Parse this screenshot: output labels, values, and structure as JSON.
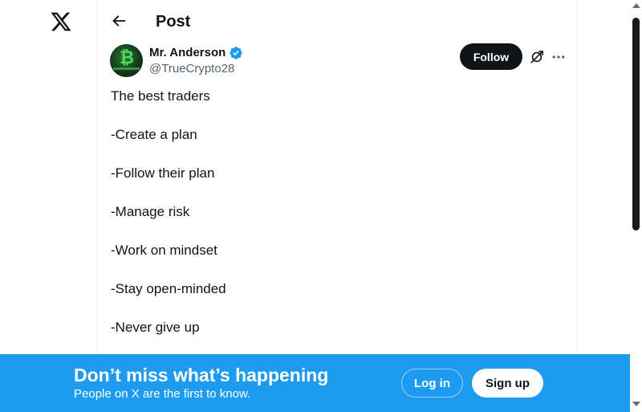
{
  "colors": {
    "accent": "#1d9bf0",
    "text_primary": "#0f1419",
    "text_secondary": "#536471",
    "follow_bg": "#0f1419",
    "verified_badge": "#1d9bf0"
  },
  "nav": {
    "logo_icon": "x-logo-icon"
  },
  "header": {
    "back_icon": "arrow-left-icon",
    "title": "Post"
  },
  "post": {
    "author": {
      "display_name": "Mr. Anderson",
      "handle": "@TrueCrypto28",
      "verified": true,
      "verified_icon": "verified-badge-icon"
    },
    "follow_label": "Follow",
    "grok_icon": "grok-icon",
    "more_icon": "more-dots-icon",
    "lines": [
      "The best traders",
      "-Create a plan",
      "-Follow their plan",
      "-Manage risk",
      "-Work on mindset",
      "-Stay open-minded",
      "-Never give up"
    ]
  },
  "bottom_bar": {
    "title": "Don’t miss what’s happening",
    "subtitle": "People on X are the first to know.",
    "login_label": "Log in",
    "signup_label": "Sign up"
  }
}
